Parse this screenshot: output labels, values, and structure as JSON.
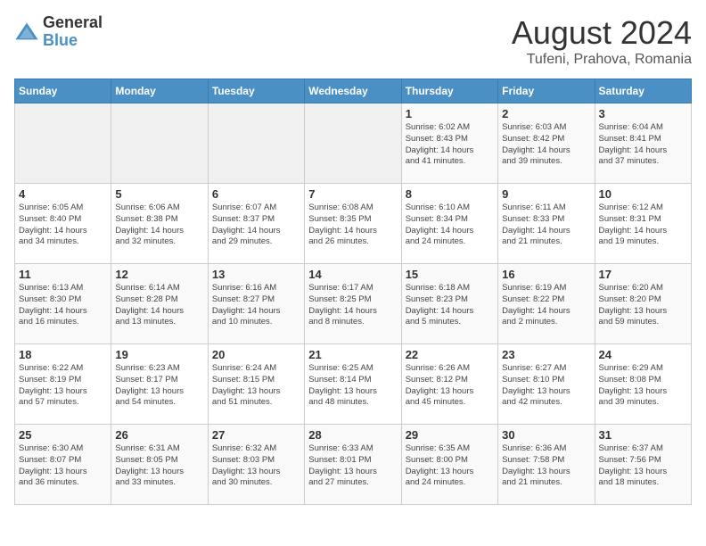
{
  "header": {
    "logo_general": "General",
    "logo_blue": "Blue",
    "month": "August 2024",
    "location": "Tufeni, Prahova, Romania"
  },
  "days_of_week": [
    "Sunday",
    "Monday",
    "Tuesday",
    "Wednesday",
    "Thursday",
    "Friday",
    "Saturday"
  ],
  "weeks": [
    [
      {
        "day": "",
        "info": ""
      },
      {
        "day": "",
        "info": ""
      },
      {
        "day": "",
        "info": ""
      },
      {
        "day": "",
        "info": ""
      },
      {
        "day": "1",
        "info": "Sunrise: 6:02 AM\nSunset: 8:43 PM\nDaylight: 14 hours\nand 41 minutes."
      },
      {
        "day": "2",
        "info": "Sunrise: 6:03 AM\nSunset: 8:42 PM\nDaylight: 14 hours\nand 39 minutes."
      },
      {
        "day": "3",
        "info": "Sunrise: 6:04 AM\nSunset: 8:41 PM\nDaylight: 14 hours\nand 37 minutes."
      }
    ],
    [
      {
        "day": "4",
        "info": "Sunrise: 6:05 AM\nSunset: 8:40 PM\nDaylight: 14 hours\nand 34 minutes."
      },
      {
        "day": "5",
        "info": "Sunrise: 6:06 AM\nSunset: 8:38 PM\nDaylight: 14 hours\nand 32 minutes."
      },
      {
        "day": "6",
        "info": "Sunrise: 6:07 AM\nSunset: 8:37 PM\nDaylight: 14 hours\nand 29 minutes."
      },
      {
        "day": "7",
        "info": "Sunrise: 6:08 AM\nSunset: 8:35 PM\nDaylight: 14 hours\nand 26 minutes."
      },
      {
        "day": "8",
        "info": "Sunrise: 6:10 AM\nSunset: 8:34 PM\nDaylight: 14 hours\nand 24 minutes."
      },
      {
        "day": "9",
        "info": "Sunrise: 6:11 AM\nSunset: 8:33 PM\nDaylight: 14 hours\nand 21 minutes."
      },
      {
        "day": "10",
        "info": "Sunrise: 6:12 AM\nSunset: 8:31 PM\nDaylight: 14 hours\nand 19 minutes."
      }
    ],
    [
      {
        "day": "11",
        "info": "Sunrise: 6:13 AM\nSunset: 8:30 PM\nDaylight: 14 hours\nand 16 minutes."
      },
      {
        "day": "12",
        "info": "Sunrise: 6:14 AM\nSunset: 8:28 PM\nDaylight: 14 hours\nand 13 minutes."
      },
      {
        "day": "13",
        "info": "Sunrise: 6:16 AM\nSunset: 8:27 PM\nDaylight: 14 hours\nand 10 minutes."
      },
      {
        "day": "14",
        "info": "Sunrise: 6:17 AM\nSunset: 8:25 PM\nDaylight: 14 hours\nand 8 minutes."
      },
      {
        "day": "15",
        "info": "Sunrise: 6:18 AM\nSunset: 8:23 PM\nDaylight: 14 hours\nand 5 minutes."
      },
      {
        "day": "16",
        "info": "Sunrise: 6:19 AM\nSunset: 8:22 PM\nDaylight: 14 hours\nand 2 minutes."
      },
      {
        "day": "17",
        "info": "Sunrise: 6:20 AM\nSunset: 8:20 PM\nDaylight: 13 hours\nand 59 minutes."
      }
    ],
    [
      {
        "day": "18",
        "info": "Sunrise: 6:22 AM\nSunset: 8:19 PM\nDaylight: 13 hours\nand 57 minutes."
      },
      {
        "day": "19",
        "info": "Sunrise: 6:23 AM\nSunset: 8:17 PM\nDaylight: 13 hours\nand 54 minutes."
      },
      {
        "day": "20",
        "info": "Sunrise: 6:24 AM\nSunset: 8:15 PM\nDaylight: 13 hours\nand 51 minutes."
      },
      {
        "day": "21",
        "info": "Sunrise: 6:25 AM\nSunset: 8:14 PM\nDaylight: 13 hours\nand 48 minutes."
      },
      {
        "day": "22",
        "info": "Sunrise: 6:26 AM\nSunset: 8:12 PM\nDaylight: 13 hours\nand 45 minutes."
      },
      {
        "day": "23",
        "info": "Sunrise: 6:27 AM\nSunset: 8:10 PM\nDaylight: 13 hours\nand 42 minutes."
      },
      {
        "day": "24",
        "info": "Sunrise: 6:29 AM\nSunset: 8:08 PM\nDaylight: 13 hours\nand 39 minutes."
      }
    ],
    [
      {
        "day": "25",
        "info": "Sunrise: 6:30 AM\nSunset: 8:07 PM\nDaylight: 13 hours\nand 36 minutes."
      },
      {
        "day": "26",
        "info": "Sunrise: 6:31 AM\nSunset: 8:05 PM\nDaylight: 13 hours\nand 33 minutes."
      },
      {
        "day": "27",
        "info": "Sunrise: 6:32 AM\nSunset: 8:03 PM\nDaylight: 13 hours\nand 30 minutes."
      },
      {
        "day": "28",
        "info": "Sunrise: 6:33 AM\nSunset: 8:01 PM\nDaylight: 13 hours\nand 27 minutes."
      },
      {
        "day": "29",
        "info": "Sunrise: 6:35 AM\nSunset: 8:00 PM\nDaylight: 13 hours\nand 24 minutes."
      },
      {
        "day": "30",
        "info": "Sunrise: 6:36 AM\nSunset: 7:58 PM\nDaylight: 13 hours\nand 21 minutes."
      },
      {
        "day": "31",
        "info": "Sunrise: 6:37 AM\nSunset: 7:56 PM\nDaylight: 13 hours\nand 18 minutes."
      }
    ]
  ]
}
